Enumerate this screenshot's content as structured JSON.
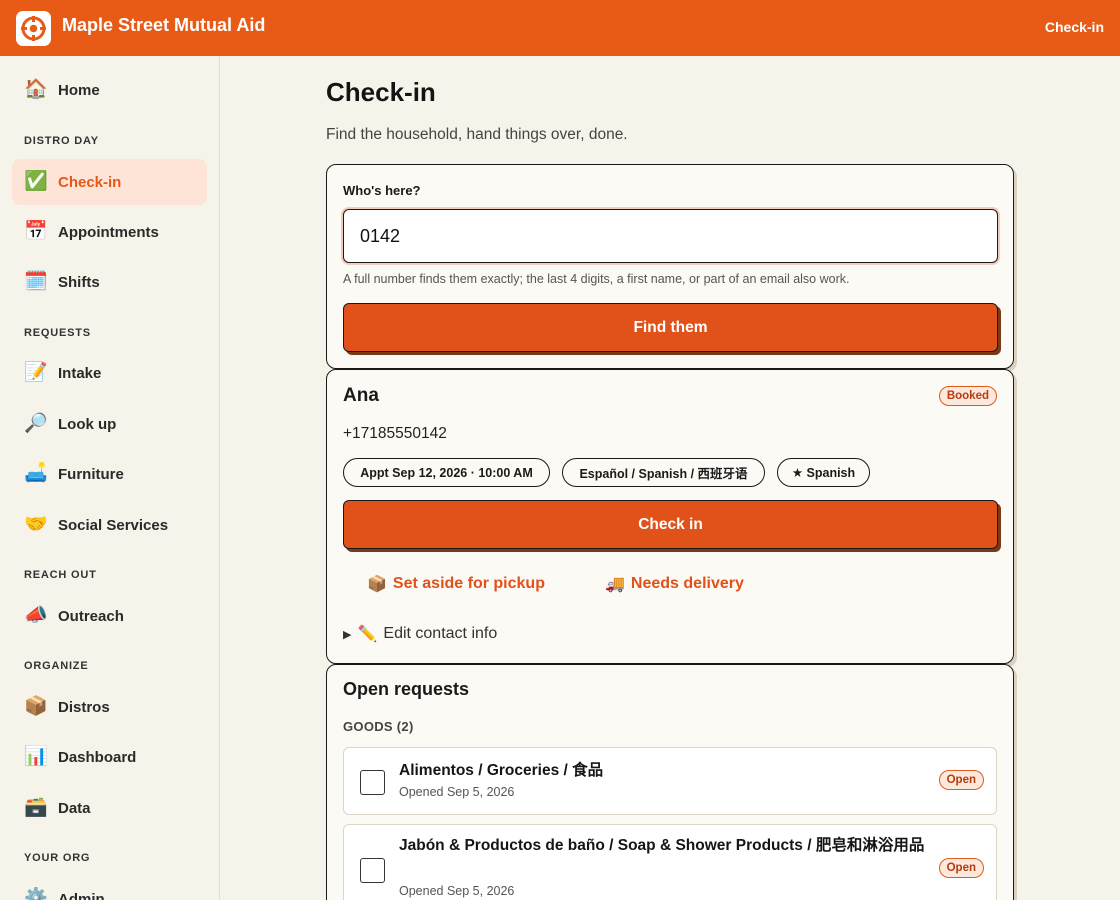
{
  "header": {
    "brand": "Maple Street Mutual Aid",
    "link": "Check-in",
    "accent": "#e85b17"
  },
  "sidebar": {
    "home": {
      "icon": "house-icon",
      "glyph": "🏠",
      "label": "Home"
    },
    "sections": [
      {
        "title": "DISTRO DAY",
        "items": [
          {
            "icon": "check-mark-icon",
            "glyph": "✅",
            "label": "Check-in",
            "active": true
          },
          {
            "icon": "calendar-icon",
            "glyph": "📅",
            "label": "Appointments"
          },
          {
            "icon": "spiral-calendar-icon",
            "glyph": "🗓️",
            "label": "Shifts"
          }
        ]
      },
      {
        "title": "REQUESTS",
        "items": [
          {
            "icon": "memo-icon",
            "glyph": "📝",
            "label": "Intake"
          },
          {
            "icon": "magnifier-icon",
            "glyph": "🔎",
            "label": "Look up"
          },
          {
            "icon": "couch-icon",
            "glyph": "🛋️",
            "label": "Furniture"
          },
          {
            "icon": "handshake-icon",
            "glyph": "🤝",
            "label": "Social Services"
          }
        ]
      },
      {
        "title": "REACH OUT",
        "items": [
          {
            "icon": "megaphone-icon",
            "glyph": "📣",
            "label": "Outreach"
          }
        ]
      },
      {
        "title": "ORGANIZE",
        "items": [
          {
            "icon": "package-icon",
            "glyph": "📦",
            "label": "Distros"
          },
          {
            "icon": "bar-chart-icon",
            "glyph": "📊",
            "label": "Dashboard"
          },
          {
            "icon": "file-box-icon",
            "glyph": "🗃️",
            "label": "Data"
          }
        ]
      },
      {
        "title": "YOUR ORG",
        "items": [
          {
            "icon": "gear-icon",
            "glyph": "⚙️",
            "label": "Admin"
          }
        ]
      }
    ]
  },
  "page": {
    "title": "Check-in",
    "subtitle": "Find the household, hand things over, done."
  },
  "search": {
    "label": "Who's here?",
    "value": "0142",
    "hint": "A full number finds them exactly; the last 4 digits, a first name, or part of an email also work.",
    "button": "Find them"
  },
  "person": {
    "name": "Ana",
    "status": "Booked",
    "phone": "+17185550142",
    "chips": [
      "Appt Sep 12, 2026 · 10:00 AM",
      "Español / Spanish / 西班牙语",
      "★ Spanish"
    ],
    "checkin_button": "Check in",
    "set_aside": {
      "glyph": "📦",
      "label": "Set aside for pickup"
    },
    "delivery": {
      "glyph": "🚚",
      "label": "Needs delivery"
    },
    "edit": {
      "glyph": "✏️",
      "label": "Edit contact info"
    }
  },
  "requests": {
    "title": "Open requests",
    "group": "GOODS (2)",
    "items": [
      {
        "title": "Alimentos / Groceries / 食品",
        "opened": "Opened Sep 5, 2026",
        "status": "Open"
      },
      {
        "title": "Jabón & Productos de baño / Soap & Shower Products / 肥皂和淋浴用品",
        "opened": "Opened Sep 5, 2026",
        "status": "Open"
      }
    ]
  }
}
